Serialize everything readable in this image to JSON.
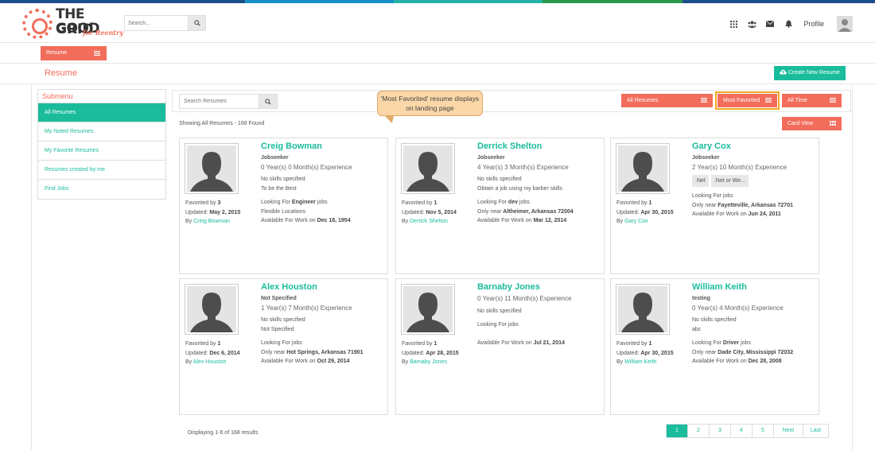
{
  "header": {
    "logo_line1": "THE GOOD",
    "logo_line2": "GRID",
    "logo_tagline": "for Reentry",
    "search_placeholder": "Search...",
    "profile_label": "Profile"
  },
  "nav": {
    "resume_tab": "Resume"
  },
  "page": {
    "title": "Resume",
    "create_button": "Create New Resume"
  },
  "submenu": {
    "title": "Submenu",
    "items": [
      {
        "label": "All Resumes"
      },
      {
        "label": "My Noted Resumes"
      },
      {
        "label": "My Favorite Resumes"
      },
      {
        "label": "Resumes created by me"
      },
      {
        "label": "Find Jobs"
      }
    ]
  },
  "toolbar": {
    "search_placeholder": "Search Resumes",
    "filter_all": "All Resumes",
    "filter_sort": "Most Favorited",
    "filter_time": "All Time",
    "view_toggle": "Card View"
  },
  "annotation": "'Most Favorited' resume displays on landing page",
  "showing_text": "Showing All Resumes - 168 Found",
  "cards": [
    {
      "name": "Creig Bowman",
      "role": "Jobseeker",
      "experience": "0 Year(s) 0 Month(s) Experience",
      "skills": "No skills specified",
      "tags": [],
      "objective": "To be the Best",
      "looking_pre": "Looking For ",
      "looking_bold": "Engineer",
      "looking_post": " jobs",
      "location_pre": "Flexible Locations",
      "location_bold": "",
      "avail_pre": "Available For Work on ",
      "avail_date": "Dec 18, 1954",
      "favorited_pre": "Favorited by ",
      "favorited_count": "3",
      "updated_pre": "Updated: ",
      "updated": "May 2, 2015",
      "by_pre": "By ",
      "by": "Creig Bowman"
    },
    {
      "name": "Derrick Shelton",
      "role": "Jobseeker",
      "experience": "4 Year(s) 3 Month(s) Experience",
      "skills": "No skills specified",
      "tags": [],
      "objective": "Obtain a job using my barber skills",
      "looking_pre": "Looking For ",
      "looking_bold": "dev",
      "looking_post": " jobs",
      "location_pre": "Only near ",
      "location_bold": "Altheimer, Arkansas 72004",
      "avail_pre": "Available For Work on ",
      "avail_date": "Mar 12, 2014",
      "favorited_pre": "Favorited by ",
      "favorited_count": "1",
      "updated_pre": "Updated: ",
      "updated": "Nov 5, 2014",
      "by_pre": "By ",
      "by": "Derrick Shelton"
    },
    {
      "name": "Gary Cox",
      "role": "Jobseeker",
      "experience": "2 Year(s) 10 Month(s) Experience",
      "skills": "",
      "tags": [
        ".Net",
        ".Net or We..."
      ],
      "objective": "",
      "looking_pre": "Looking For jobs",
      "looking_bold": "",
      "looking_post": "",
      "location_pre": "Only near ",
      "location_bold": "Fayetteville, Arkansas 72701",
      "avail_pre": "Available For Work on ",
      "avail_date": "Jun 24, 2011",
      "favorited_pre": "Favorited by ",
      "favorited_count": "1",
      "updated_pre": "Updated: ",
      "updated": "Apr 30, 2015",
      "by_pre": "By ",
      "by": "Gary Cox"
    },
    {
      "name": "Alex Houston",
      "role": "Not Specified",
      "experience": "1 Year(s) 7 Month(s) Experience",
      "skills": "No skills specified",
      "tags": [],
      "objective": "Not Specified",
      "looking_pre": "Looking For jobs",
      "looking_bold": "",
      "looking_post": "",
      "location_pre": "Only near ",
      "location_bold": "Hot Springs, Arkansas 71901",
      "avail_pre": "Available For Work on ",
      "avail_date": "Oct 29, 2014",
      "favorited_pre": "Favorited by ",
      "favorited_count": "1",
      "updated_pre": "Updated: ",
      "updated": "Dec 6, 2014",
      "by_pre": "By ",
      "by": "Alex Houston"
    },
    {
      "name": "Barnaby Jones",
      "role": "",
      "experience": "0 Year(s) 11 Month(s) Experience",
      "skills": "No skills specified",
      "tags": [],
      "objective": "",
      "looking_pre": "Looking For jobs",
      "looking_bold": "",
      "looking_post": "",
      "location_pre": "",
      "location_bold": "",
      "avail_pre": "Available For Work on ",
      "avail_date": "Jul 21, 2014",
      "favorited_pre": "Favorited by ",
      "favorited_count": "1",
      "updated_pre": "Updated: ",
      "updated": "Apr 28, 2015",
      "by_pre": "By ",
      "by": "Barnaby Jones"
    },
    {
      "name": "William Keith",
      "role": "testing",
      "experience": "0 Year(s) 4 Month(s) Experience",
      "skills": "No skills specified",
      "tags": [],
      "objective": "abc",
      "looking_pre": "Looking For ",
      "looking_bold": "Driver",
      "looking_post": " jobs",
      "location_pre": "Only near ",
      "location_bold": "Dade City, Mississippi 72032",
      "avail_pre": "Available For Work on ",
      "avail_date": "Dec 28, 2008",
      "favorited_pre": "Favorited by ",
      "favorited_count": "1",
      "updated_pre": "Updated: ",
      "updated": "Apr 30, 2015",
      "by_pre": "By ",
      "by": "William Keith"
    }
  ],
  "footer": {
    "displaying": "Displaying 1-6 of 168 results",
    "pages": [
      "1",
      "2",
      "3",
      "4",
      "5"
    ],
    "next": "Next",
    "last": "Last"
  },
  "colors": {
    "accent": "#f26d5b",
    "teal": "#1abc9c",
    "highlight": "#f5a623"
  }
}
